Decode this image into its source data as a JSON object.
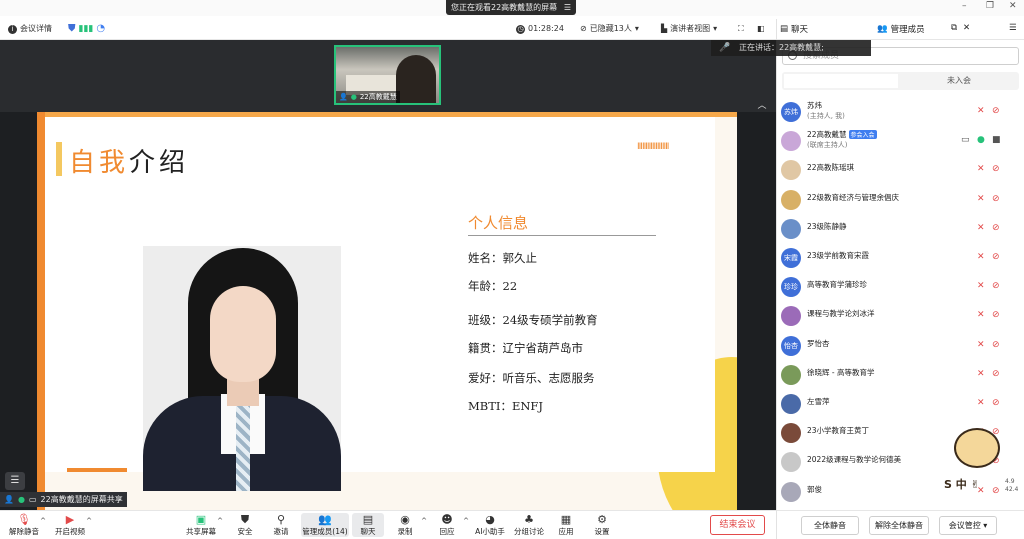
{
  "banner": {
    "text": "您正在观看22高教戴慧的屏幕",
    "menu_icon": "menu-icon"
  },
  "window": {
    "minimize": "–",
    "restore": "❐",
    "close": "✕"
  },
  "top_toolbar": {
    "meeting_details": "会议详情",
    "timer": "01:28:24",
    "hidden": "已隐藏13人",
    "view": "演讲者视图"
  },
  "stage": {
    "thumb_label": "22高教戴慧",
    "speaking": "正在讲话：22高教戴慧;",
    "share_label": "22高教戴慧的屏幕共享",
    "left_menu_icon": "☰"
  },
  "slide": {
    "title_highlight": "自我",
    "title_rest": "介绍",
    "decor": "IIIIIIIIIIIIIIIIIII",
    "info_heading": "个人信息",
    "info": [
      "姓名：郭久止",
      "年龄：22",
      "班级：24级专硕学前教育",
      "籍贯：辽宁省葫芦岛市",
      "爱好：听音乐、志愿服务",
      "MBTI：ENFJ"
    ]
  },
  "bottom_toolbar": {
    "unmute": "解除静音",
    "start_video": "开启视频",
    "share": "共享屏幕",
    "security": "安全",
    "invite": "邀请",
    "manage": "管理成员(14)",
    "chat": "聊天",
    "record": "录制",
    "react": "回应",
    "assistant": "AI小助手",
    "breakout": "分组讨论",
    "apps": "应用",
    "settings": "设置",
    "end": "结束会议"
  },
  "panel": {
    "tab_chat": "聊天",
    "tab_members": "管理成员",
    "search_placeholder": "搜索成员",
    "subtab_joined": "",
    "subtab_not_joined": "未入会",
    "members": [
      {
        "avatar": "苏炜",
        "name": "苏炜",
        "sub": "(主持人, 我)",
        "color": "#3f6fd8"
      },
      {
        "avatar": "",
        "name": "22高教戴慧",
        "badge": "参会入会",
        "sub": "(联席主持人)",
        "color": "#c9a7d8"
      },
      {
        "avatar": "",
        "name": "22高教陈瑶琪",
        "color": "#e0c7a4"
      },
      {
        "avatar": "",
        "name": "22级教育经济与管理余倡庆",
        "color": "#d8b066"
      },
      {
        "avatar": "",
        "name": "23级陈静静",
        "color": "#6a8fc8"
      },
      {
        "avatar": "宋霞",
        "name": "23级学前教育宋霞",
        "color": "#3f6fd8"
      },
      {
        "avatar": "珍珍",
        "name": "高等教育学蒲珍珍",
        "color": "#3f6fd8"
      },
      {
        "avatar": "",
        "name": "课程与教学论刘冰洋",
        "color": "#9b6bb8"
      },
      {
        "avatar": "怡杏",
        "name": "罗怡杏",
        "color": "#3f6fd8"
      },
      {
        "avatar": "",
        "name": "徐晓辉 - 高等教育学",
        "color": "#7a9a5a"
      },
      {
        "avatar": "",
        "name": "左雪萍",
        "color": "#4a6aa8"
      },
      {
        "avatar": "",
        "name": "23小学教育王黄丁",
        "color": "#7a4a3a"
      },
      {
        "avatar": "",
        "name": "2022级课程与教学论何德美",
        "color": "#c8c8c8"
      },
      {
        "avatar": "",
        "name": "郭俊",
        "color": "#a8a8b8"
      }
    ],
    "mute_all": "全体静音",
    "unmute_all": "解除全体静音",
    "control": "会议管控"
  },
  "sticker_text": "S 中 ✌",
  "metrics": [
    "4.9",
    "42.4"
  ]
}
